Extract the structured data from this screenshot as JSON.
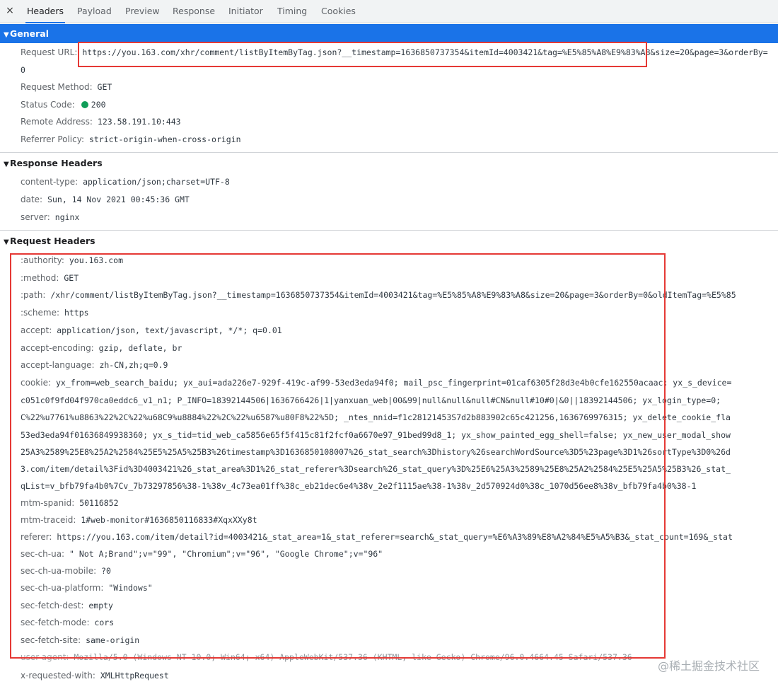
{
  "tabs": [
    {
      "label": "Headers",
      "active": true
    },
    {
      "label": "Payload",
      "active": false
    },
    {
      "label": "Preview",
      "active": false
    },
    {
      "label": "Response",
      "active": false
    },
    {
      "label": "Initiator",
      "active": false
    },
    {
      "label": "Timing",
      "active": false
    },
    {
      "label": "Cookies",
      "active": false
    }
  ],
  "close_glyph": "×",
  "sections": {
    "general": {
      "title": "General"
    },
    "response": {
      "title": "Response Headers"
    },
    "request": {
      "title": "Request Headers"
    }
  },
  "general": [
    {
      "k": "Request URL:",
      "v": "https://you.163.com/xhr/comment/listByItemByTag.json?__timestamp=1636850737354&itemId=4003421&tag=%E5%85%A8%E9%83%A8&size=20&page=3&orderBy="
    },
    {
      "k": "",
      "v": "0"
    },
    {
      "k": "Request Method:",
      "v": "GET"
    },
    {
      "k": "Status Code:",
      "v": "200"
    },
    {
      "k": "Remote Address:",
      "v": "123.58.191.10:443"
    },
    {
      "k": "Referrer Policy:",
      "v": "strict-origin-when-cross-origin"
    }
  ],
  "response_headers": [
    {
      "k": "content-type:",
      "v": "application/json;charset=UTF-8"
    },
    {
      "k": "date:",
      "v": "Sun, 14 Nov 2021 00:45:36 GMT"
    },
    {
      "k": "server:",
      "v": "nginx"
    }
  ],
  "request_headers": [
    {
      "k": ":authority:",
      "v": "you.163.com"
    },
    {
      "k": ":method:",
      "v": "GET"
    },
    {
      "k": ":path:",
      "v": "/xhr/comment/listByItemByTag.json?__timestamp=1636850737354&itemId=4003421&tag=%E5%85%A8%E9%83%A8&size=20&page=3&orderBy=0&oldItemTag=%E5%85"
    },
    {
      "k": ":scheme:",
      "v": "https"
    },
    {
      "k": "accept:",
      "v": "application/json, text/javascript, */*; q=0.01"
    },
    {
      "k": "accept-encoding:",
      "v": "gzip, deflate, br"
    },
    {
      "k": "accept-language:",
      "v": "zh-CN,zh;q=0.9"
    },
    {
      "k": "cookie:",
      "v": "yx_from=web_search_baidu; yx_aui=ada226e7-929f-419c-af99-53ed3eda94f0; mail_psc_fingerprint=01caf6305f28d3e4b0cfe162550acaac; yx_s_device="
    },
    {
      "k": "",
      "v": "c051c0f9fd04f970ca0eddc6_v1_n1; P_INFO=18392144506|1636766426|1|yanxuan_web|00&99|null&null&null#CN&null#10#0|&0||18392144506; yx_login_type=0;"
    },
    {
      "k": "",
      "v": "C%22%u7761%u8863%22%2C%22%u68C9%u8884%22%2C%22%u6587%u80F8%22%5D; _ntes_nnid=f1c28121453S7d2b883902c65c421256,1636769976315; yx_delete_cookie_fla"
    },
    {
      "k": "",
      "v": "53ed3eda94f01636849938360; yx_s_tid=tid_web_ca5856e65f5f415c81f2fcf0a6670e97_91bed99d8_1; yx_show_painted_egg_shell=false; yx_new_user_modal_show"
    },
    {
      "k": "",
      "v": "25A3%2589%25E8%25A2%2584%25E5%25A5%25B3%26timestamp%3D1636850108007%26_stat_search%3Dhistory%26searchWordSource%3D5%23page%3D1%26sortType%3D0%26d"
    },
    {
      "k": "",
      "v": "3.com/item/detail%3Fid%3D4003421%26_stat_area%3D1%26_stat_referer%3Dsearch%26_stat_query%3D%25E6%25A3%2589%25E8%25A2%2584%25E5%25A5%25B3%26_stat_"
    },
    {
      "k": "",
      "v": "qList=v_bfb79fa4b0%7Cv_7b73297856%38-1%38v_4c73ea01ff%38c_eb21dec6e4%38v_2e2f1115ae%38-1%38v_2d570924d0%38c_1070d56ee8%38v_bfb79fa4b0%38-1"
    },
    {
      "k": "mtm-spanid:",
      "v": "50116852"
    },
    {
      "k": "mtm-traceid:",
      "v": "1#web-monitor#1636850116833#XqxXXy8t"
    },
    {
      "k": "referer:",
      "v": "https://you.163.com/item/detail?id=4003421&_stat_area=1&_stat_referer=search&_stat_query=%E6%A3%89%E8%A2%84%E5%A5%B3&_stat_count=169&_stat"
    },
    {
      "k": "sec-ch-ua:",
      "v": "\" Not A;Brand\";v=\"99\", \"Chromium\";v=\"96\", \"Google Chrome\";v=\"96\""
    },
    {
      "k": "sec-ch-ua-mobile:",
      "v": "?0"
    },
    {
      "k": "sec-ch-ua-platform:",
      "v": "\"Windows\""
    },
    {
      "k": "sec-fetch-dest:",
      "v": "empty"
    },
    {
      "k": "sec-fetch-mode:",
      "v": "cors"
    },
    {
      "k": "sec-fetch-site:",
      "v": "same-origin"
    },
    {
      "k": "user-agent:",
      "v": "Mozilla/5.0 (Windows NT 10.0; Win64; x64) AppleWebKit/537.36 (KHTML, like Gecko) Chrome/96.0.4664.45 Safari/537.36"
    },
    {
      "k": "x-requested-with:",
      "v": "XMLHttpRequest"
    }
  ],
  "watermark": "@稀土掘金技术社区",
  "colors": {
    "selected_header": "#1a73e8",
    "highlight": "#e53935",
    "status_ok": "#0f9d58"
  }
}
